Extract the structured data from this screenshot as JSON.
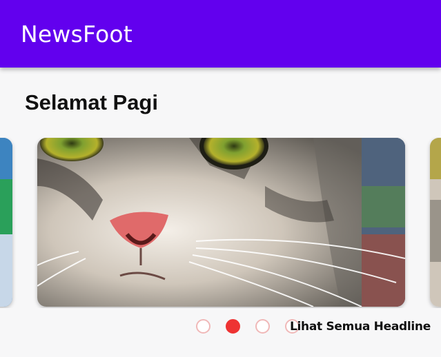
{
  "app_bar": {
    "title": "NewsFoot",
    "background_color": "#6200ee"
  },
  "greeting": "Selamat Pagi",
  "headline_carousel": {
    "active_index": 1,
    "dot_count": 4,
    "slides": [
      {
        "image": "cat-photo"
      },
      {
        "image": "cat-photo"
      },
      {
        "image": "cat-photo"
      }
    ],
    "dot_active_color": "#ee3333",
    "dot_inactive_border_color": "#f0b8b8"
  },
  "see_all_link": "Lihat Semua Headline"
}
